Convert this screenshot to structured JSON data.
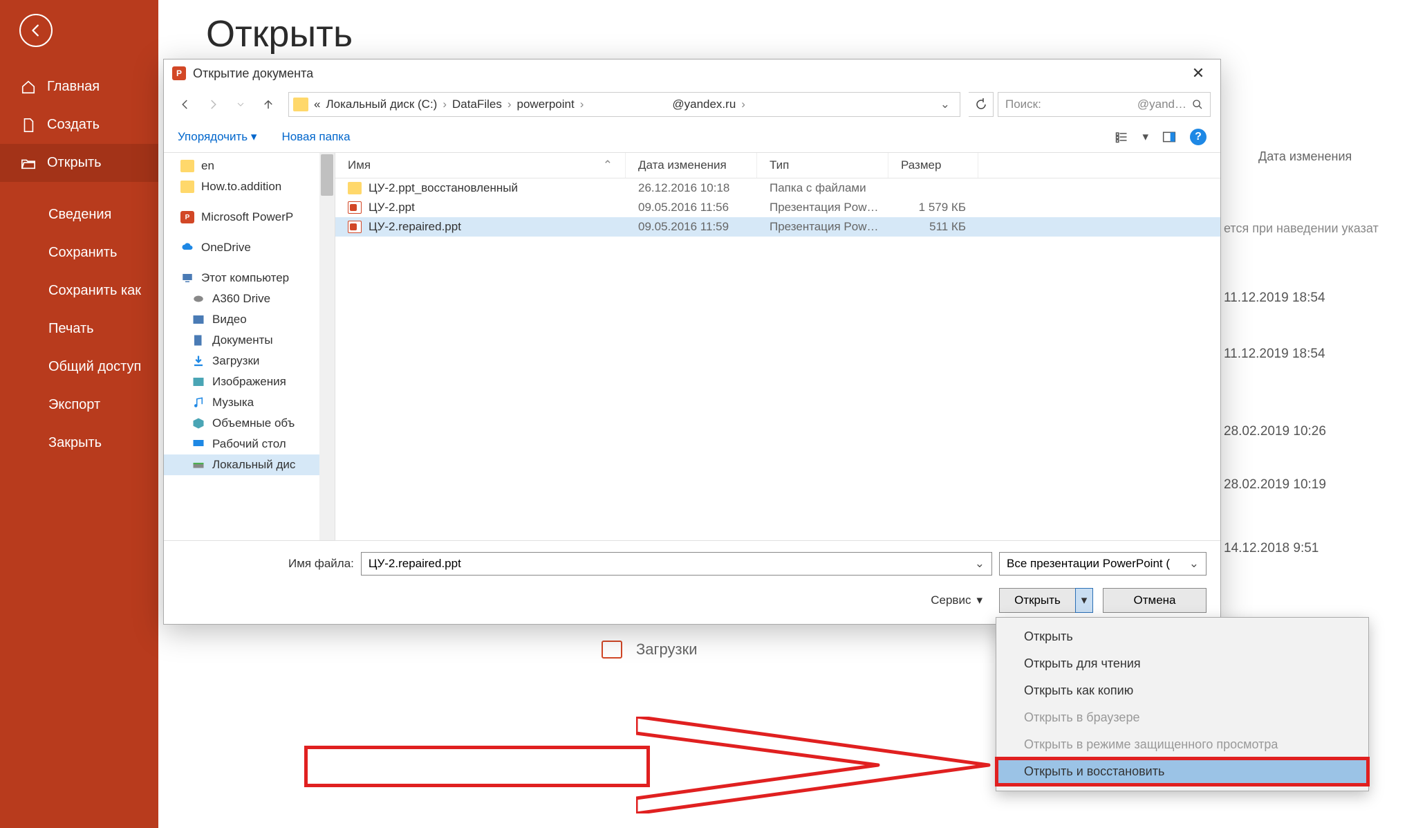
{
  "sidebar": {
    "items": [
      {
        "label": "Главная"
      },
      {
        "label": "Создать"
      },
      {
        "label": "Открыть"
      }
    ],
    "subitems": [
      {
        "label": "Сведения"
      },
      {
        "label": "Сохранить"
      },
      {
        "label": "Сохранить как"
      },
      {
        "label": "Печать"
      },
      {
        "label": "Общий доступ"
      },
      {
        "label": "Экспорт"
      },
      {
        "label": "Закрыть"
      }
    ]
  },
  "page": {
    "title": "Открыть"
  },
  "dialog": {
    "title": "Открытие документа",
    "breadcrumb": {
      "segments": [
        "«",
        "Локальный диск (C:)",
        "DataFiles",
        "powerpoint",
        "@yandex.ru"
      ]
    },
    "search": {
      "placeholder": "Поиск:",
      "suffix": "@yand…"
    },
    "toolbar": {
      "organize": "Упорядочить",
      "newfolder": "Новая папка"
    },
    "tree": [
      {
        "label": "en",
        "icon": "folder"
      },
      {
        "label": "How.to.addition",
        "icon": "folder"
      },
      {
        "label": "Microsoft PowerP",
        "icon": "ppt"
      },
      {
        "label": "OneDrive",
        "icon": "cloud"
      },
      {
        "label": "Этот компьютер",
        "icon": "pc"
      },
      {
        "label": "A360 Drive",
        "icon": "disk"
      },
      {
        "label": "Видео",
        "icon": "video"
      },
      {
        "label": "Документы",
        "icon": "docs"
      },
      {
        "label": "Загрузки",
        "icon": "download"
      },
      {
        "label": "Изображения",
        "icon": "images"
      },
      {
        "label": "Музыка",
        "icon": "music"
      },
      {
        "label": "Объемные объ",
        "icon": "cube"
      },
      {
        "label": "Рабочий стол",
        "icon": "desktop"
      },
      {
        "label": "Локальный дис",
        "icon": "drive",
        "selected": true
      }
    ],
    "columns": {
      "name": "Имя",
      "date": "Дата изменения",
      "type": "Тип",
      "size": "Размер"
    },
    "files": [
      {
        "name": "ЦУ-2.ppt_восстановленный",
        "date": "26.12.2016 10:18",
        "type": "Папка с файлами",
        "size": "",
        "icon": "folder"
      },
      {
        "name": "ЦУ-2.ppt",
        "date": "09.05.2016 11:56",
        "type": "Презентация Pow…",
        "size": "1 579 КБ",
        "icon": "ppt"
      },
      {
        "name": "ЦУ-2.repaired.ppt",
        "date": "09.05.2016 11:59",
        "type": "Презентация Pow…",
        "size": "511 КБ",
        "icon": "ppt",
        "selected": true
      }
    ],
    "filename": {
      "label": "Имя файла:",
      "value": "ЦУ-2.repaired.ppt"
    },
    "filetype": "Все презентации PowerPoint (",
    "service": "Сервис",
    "open_btn": "Открыть",
    "cancel_btn": "Отмена"
  },
  "dropdown": [
    {
      "label": "Открыть"
    },
    {
      "label": "Открыть для чтения"
    },
    {
      "label": "Открыть как копию"
    },
    {
      "label": "Открыть в браузере",
      "disabled": true
    },
    {
      "label": "Открыть в режиме защищенного просмотра",
      "disabled": true
    },
    {
      "label": "Открыть и восстановить",
      "highlight": true
    }
  ],
  "bg": {
    "header_date": "Дата изменения",
    "hover_text": "ется при наведении указат",
    "rows": [
      {
        "date": "11.12.2019 18:54"
      },
      {
        "date": "11.12.2019 18:54"
      },
      {
        "date": "28.02.2019 10:26"
      },
      {
        "date": "28.02.2019 10:19"
      },
      {
        "date": "14.12.2018 9:51"
      }
    ],
    "downloads": "Загрузки"
  }
}
